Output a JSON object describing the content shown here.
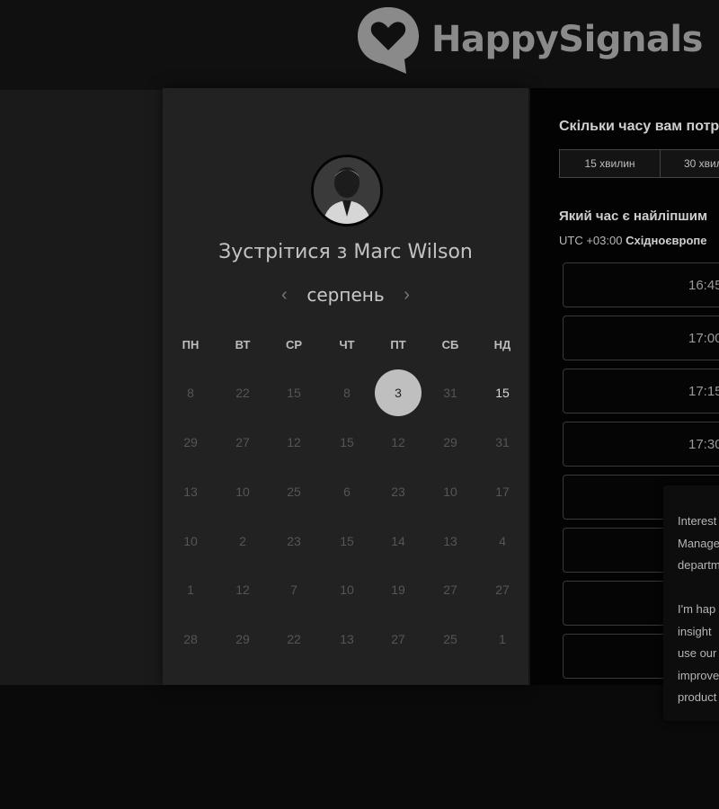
{
  "brand": {
    "logo_text": "HappySignals"
  },
  "scheduler": {
    "meet_prefix": "Зустрітися з",
    "host_name": "Marc Wilson",
    "month": "серпень",
    "prev_arrow": "‹",
    "next_arrow": "›",
    "weekdays": [
      "ПН",
      "ВТ",
      "СР",
      "ЧТ",
      "ПТ",
      "СБ",
      "НД"
    ],
    "weeks": [
      [
        "8",
        "22",
        "15",
        "8",
        "3",
        "31",
        "15"
      ],
      [
        "29",
        "27",
        "12",
        "15",
        "12",
        "29",
        "31"
      ],
      [
        "13",
        "10",
        "25",
        "6",
        "23",
        "10",
        "17"
      ],
      [
        "10",
        "2",
        "23",
        "15",
        "14",
        "13",
        "4"
      ],
      [
        "1",
        "12",
        "7",
        "10",
        "19",
        "27",
        "27"
      ],
      [
        "28",
        "29",
        "22",
        "13",
        "27",
        "25",
        "1"
      ]
    ],
    "selected_day": "3",
    "available_days": [
      "15"
    ]
  },
  "booking": {
    "duration_question": "Скільки часу вам потр",
    "durations": [
      "15 хвилин",
      "30 хвил"
    ],
    "time_question": "Який час є найліпшим",
    "timezone_offset": "UTC +03:00",
    "timezone_name": "Східноєвропе",
    "slots": [
      "16:45",
      "17:00",
      "17:15",
      "17:30",
      "",
      "",
      "",
      ""
    ]
  },
  "chat_popup": {
    "lines": [
      "Interest",
      "Manage",
      "departm",
      "",
      "I'm hap",
      "insight",
      "use our",
      "improve",
      "product"
    ]
  },
  "colors": {
    "selected_day_bg": "#bfbfbf",
    "card_bg": "#222222",
    "panel_bg": "#030303"
  }
}
